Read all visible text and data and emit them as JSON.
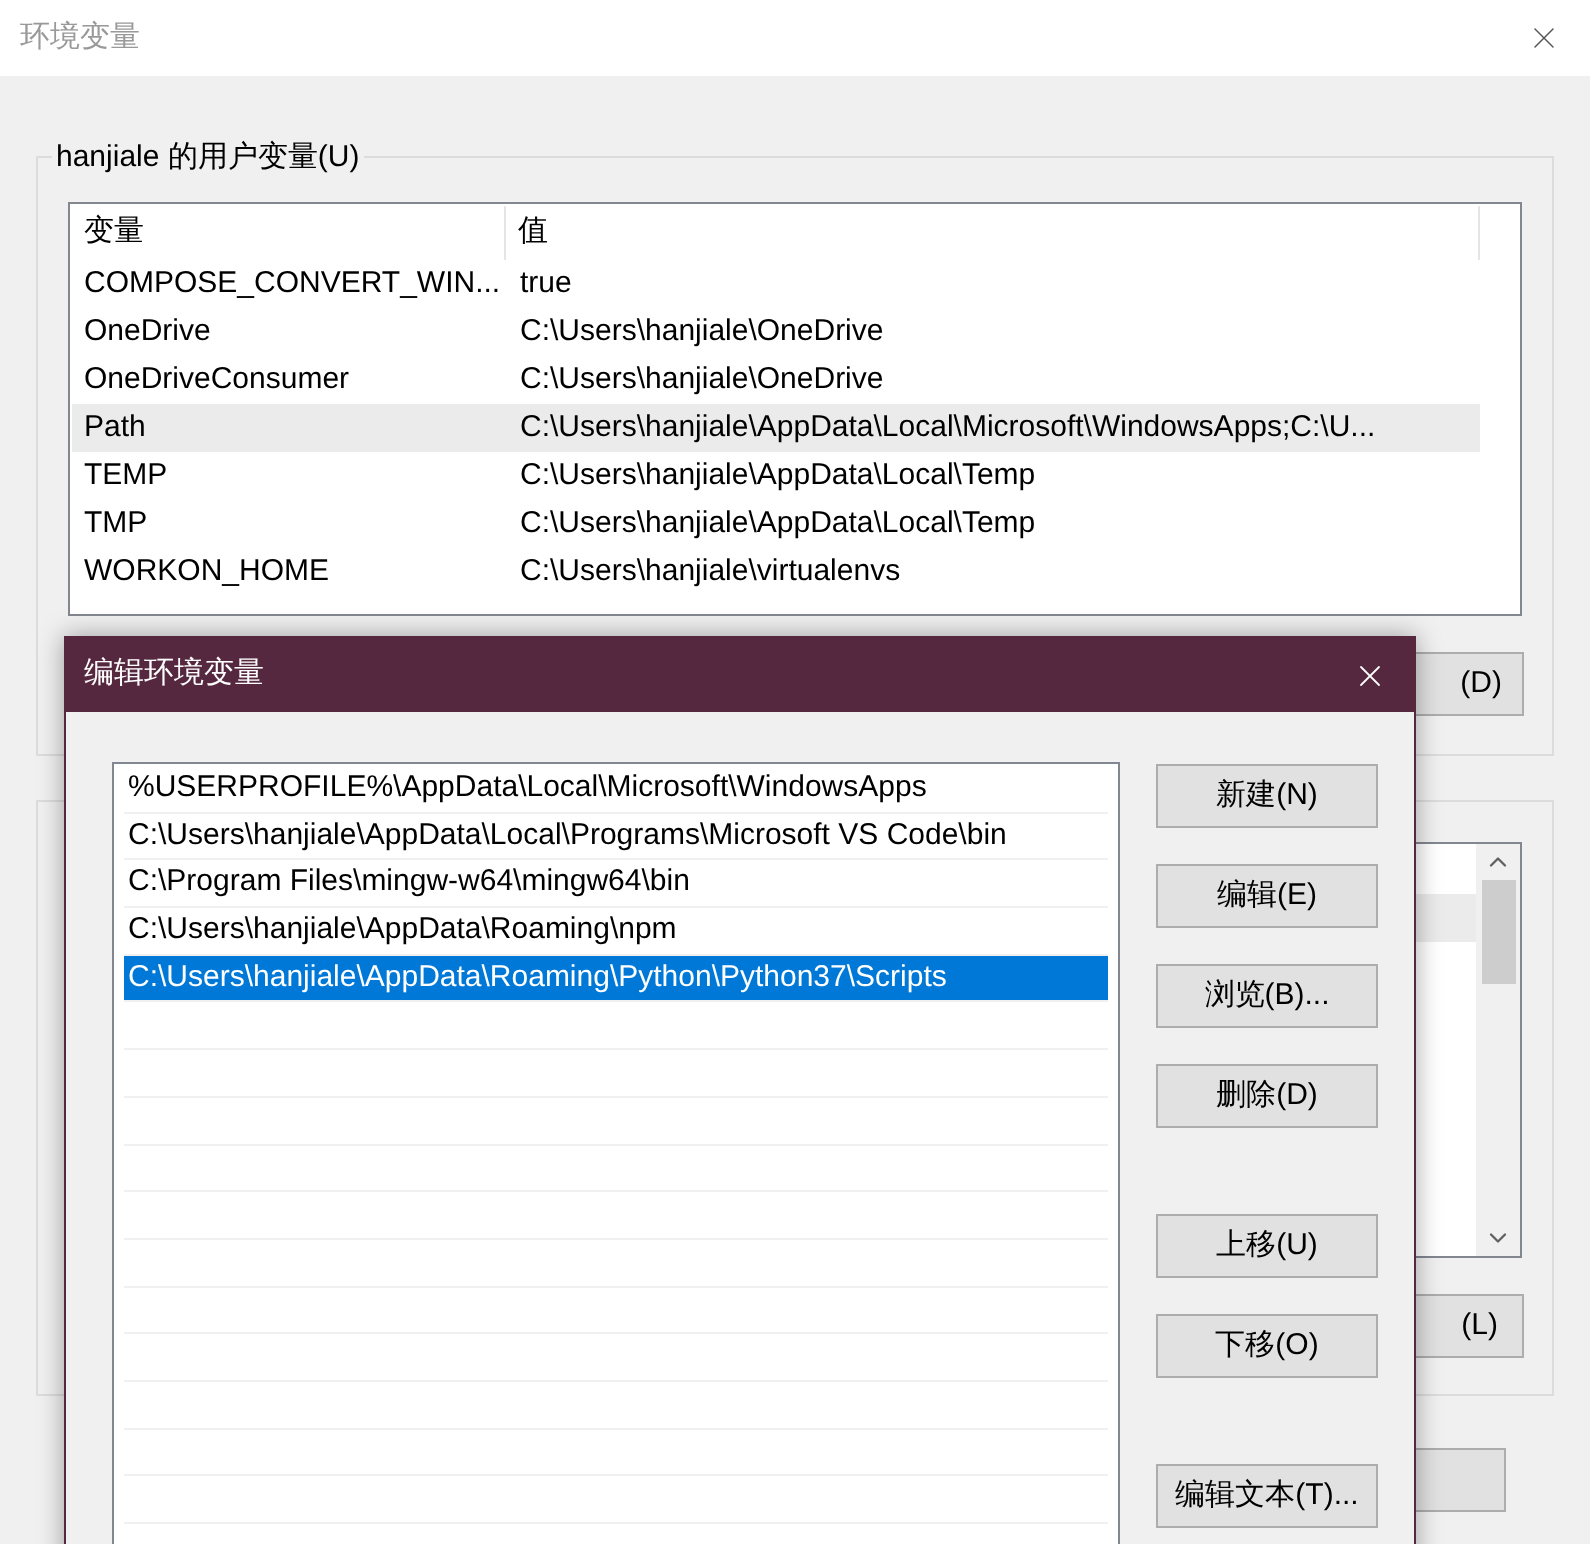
{
  "window": {
    "title": "环境变量"
  },
  "user_vars": {
    "title": "hanjiale 的用户变量(U)",
    "columns": [
      "变量",
      "值"
    ],
    "rows": [
      {
        "name": "COMPOSE_CONVERT_WIN...",
        "value": "true",
        "selected": false
      },
      {
        "name": "OneDrive",
        "value": "C:\\Users\\hanjiale\\OneDrive",
        "selected": false
      },
      {
        "name": "OneDriveConsumer",
        "value": "C:\\Users\\hanjiale\\OneDrive",
        "selected": false
      },
      {
        "name": "Path",
        "value": "C:\\Users\\hanjiale\\AppData\\Local\\Microsoft\\WindowsApps;C:\\U...",
        "selected": true
      },
      {
        "name": "TEMP",
        "value": "C:\\Users\\hanjiale\\AppData\\Local\\Temp",
        "selected": false
      },
      {
        "name": "TMP",
        "value": "C:\\Users\\hanjiale\\AppData\\Local\\Temp",
        "selected": false
      },
      {
        "name": "WORKON_HOME",
        "value": "C:\\Users\\hanjiale\\virtualenvs",
        "selected": false
      }
    ],
    "button": "(D)"
  },
  "system_vars": {
    "button": "(L)"
  },
  "dialog": {
    "title": "编辑环境变量",
    "items": [
      {
        "text": "%USERPROFILE%\\AppData\\Local\\Microsoft\\WindowsApps",
        "selected": false
      },
      {
        "text": "C:\\Users\\hanjiale\\AppData\\Local\\Programs\\Microsoft VS Code\\bin",
        "selected": false
      },
      {
        "text": "C:\\Program Files\\mingw-w64\\mingw64\\bin",
        "selected": false
      },
      {
        "text": "C:\\Users\\hanjiale\\AppData\\Roaming\\npm",
        "selected": false
      },
      {
        "text": "C:\\Users\\hanjiale\\AppData\\Roaming\\Python\\Python37\\Scripts",
        "selected": true
      }
    ],
    "button_groups": [
      [
        "新建(N)",
        "编辑(E)",
        "浏览(B)...",
        "删除(D)"
      ],
      [
        "上移(U)",
        "下移(O)"
      ],
      [
        "编辑文本(T)..."
      ]
    ]
  }
}
